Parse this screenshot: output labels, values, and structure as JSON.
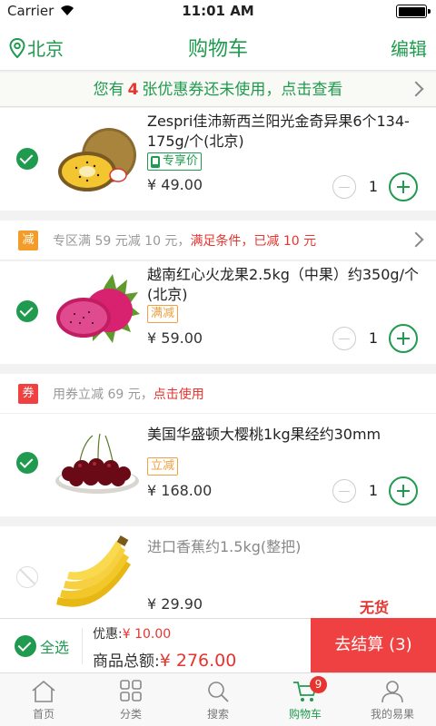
{
  "status_bar": {
    "carrier": "Carrier",
    "time": "11:01 AM"
  },
  "nav": {
    "location": "北京",
    "title": "购物车",
    "edit": "编辑"
  },
  "coupon_notice": {
    "prefix": "您有",
    "count": "4",
    "suffix": "张优惠券还未使用，点击查看"
  },
  "items": [
    {
      "name": "Zespri佳沛新西兰阳光金奇异果6个134-175g/个(北京)",
      "tag": "专享价",
      "price": "¥ 49.00",
      "qty": "1",
      "image": "kiwi-fruit"
    },
    {
      "name": "越南红心火龙果2.5kg（中果）约350g/个(北京)",
      "tag": "满减",
      "price": "¥ 59.00",
      "qty": "1",
      "image": "dragon-fruit"
    },
    {
      "name": "美国华盛顿大樱桃1kg果经约30mm",
      "tag": "立减",
      "price": "¥ 168.00",
      "qty": "1",
      "image": "cherries"
    },
    {
      "name": "进口香蕉约1.5kg(整把)",
      "tag": "",
      "price": "¥ 29.90",
      "qty": "",
      "status": "无货",
      "image": "bananas"
    }
  ],
  "promos": [
    {
      "badge": "减",
      "badge_color": "#f39c2a",
      "text": "专区满 59 元减 10 元，",
      "highlight": "满足条件，已减 10 元"
    },
    {
      "badge": "券",
      "badge_color": "#ef4141",
      "text": "用券立减 69 元，",
      "highlight": "点击使用"
    }
  ],
  "bottom": {
    "select_all": "全选",
    "discount_label": "优惠:",
    "discount_value": "¥ 10.00",
    "total_label": "商品总额:",
    "total_value": "¥ 276.00",
    "checkout": "去结算 (3)"
  },
  "tabs": [
    {
      "label": "首页",
      "icon": "home-icon"
    },
    {
      "label": "分类",
      "icon": "grid-icon"
    },
    {
      "label": "搜索",
      "icon": "search-icon"
    },
    {
      "label": "购物车",
      "icon": "cart-icon",
      "badge": "9"
    },
    {
      "label": "我的易果",
      "icon": "user-icon"
    }
  ],
  "colors": {
    "brand_green": "#1f9a4f",
    "accent_red": "#ef4141",
    "promo_orange": "#f39c2a"
  }
}
